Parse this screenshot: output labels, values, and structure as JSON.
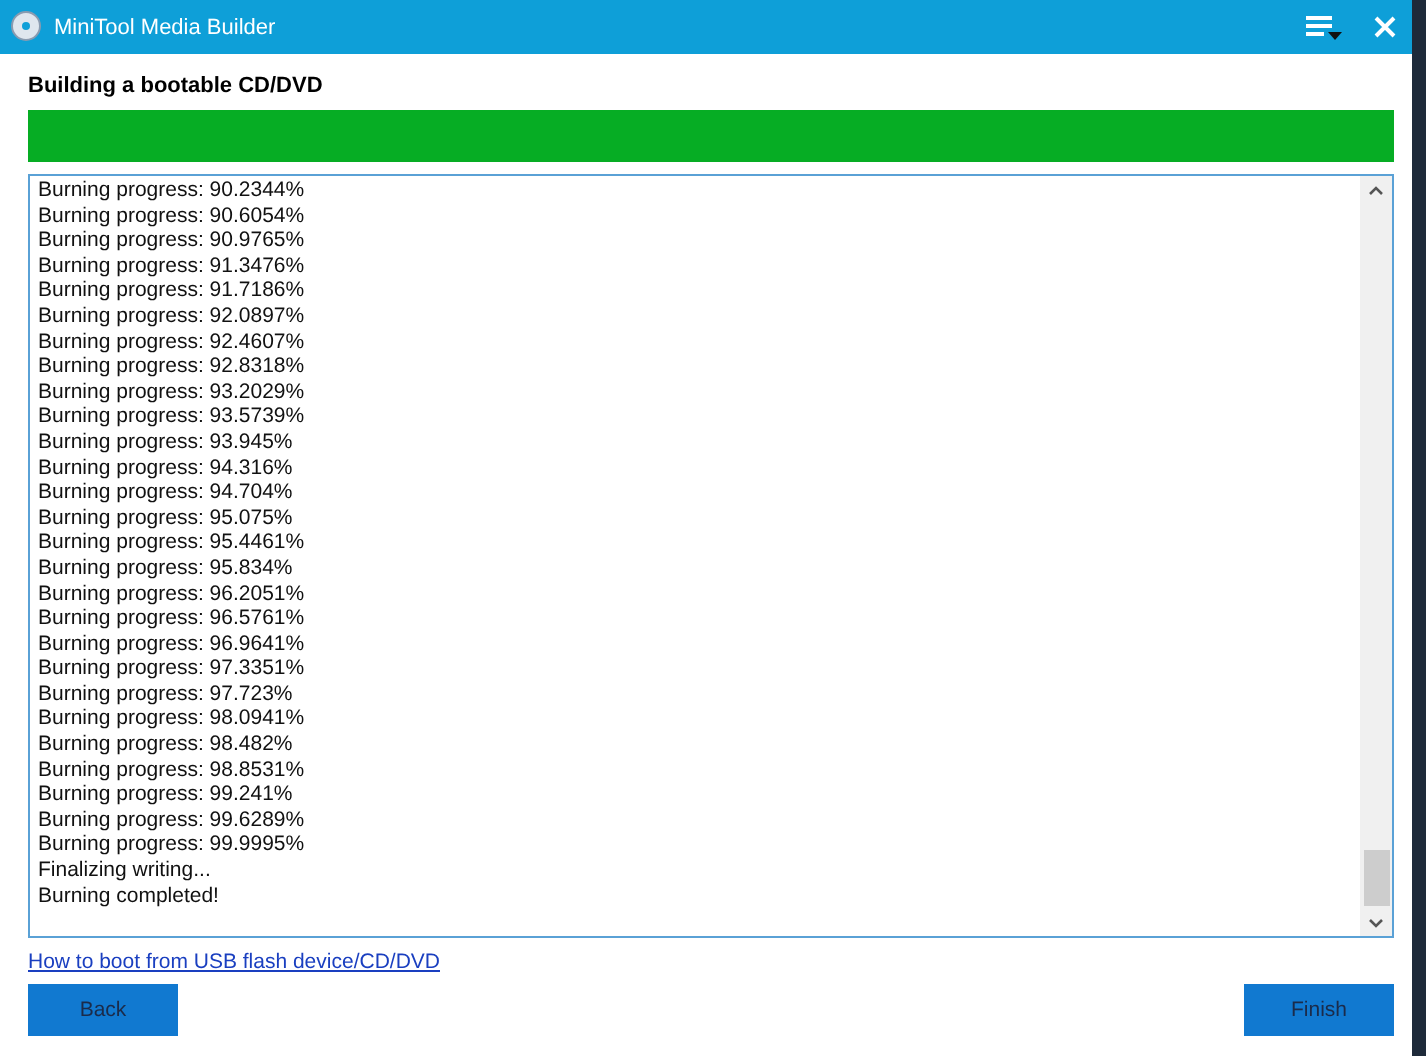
{
  "window": {
    "title": "MiniTool Media Builder"
  },
  "heading": "Building a bootable CD/DVD",
  "progress": {
    "level": 1
  },
  "log": [
    "Burning progress: 90.2344%",
    "Burning progress: 90.6054%",
    "Burning progress: 90.9765%",
    "Burning progress: 91.3476%",
    "Burning progress: 91.7186%",
    "Burning progress: 92.0897%",
    "Burning progress: 92.4607%",
    "Burning progress: 92.8318%",
    "Burning progress: 93.2029%",
    "Burning progress: 93.5739%",
    "Burning progress: 93.945%",
    "Burning progress: 94.316%",
    "Burning progress: 94.704%",
    "Burning progress: 95.075%",
    "Burning progress: 95.4461%",
    "Burning progress: 95.834%",
    "Burning progress: 96.2051%",
    "Burning progress: 96.5761%",
    "Burning progress: 96.9641%",
    "Burning progress: 97.3351%",
    "Burning progress: 97.723%",
    "Burning progress: 98.0941%",
    "Burning progress: 98.482%",
    "Burning progress: 98.8531%",
    "Burning progress: 99.241%",
    "Burning progress: 99.6289%",
    "Burning progress: 99.9995%",
    "Finalizing writing...",
    "Burning completed!"
  ],
  "help_link": "How to boot from USB flash device/CD/DVD",
  "buttons": [
    "Back",
    "Finish"
  ]
}
